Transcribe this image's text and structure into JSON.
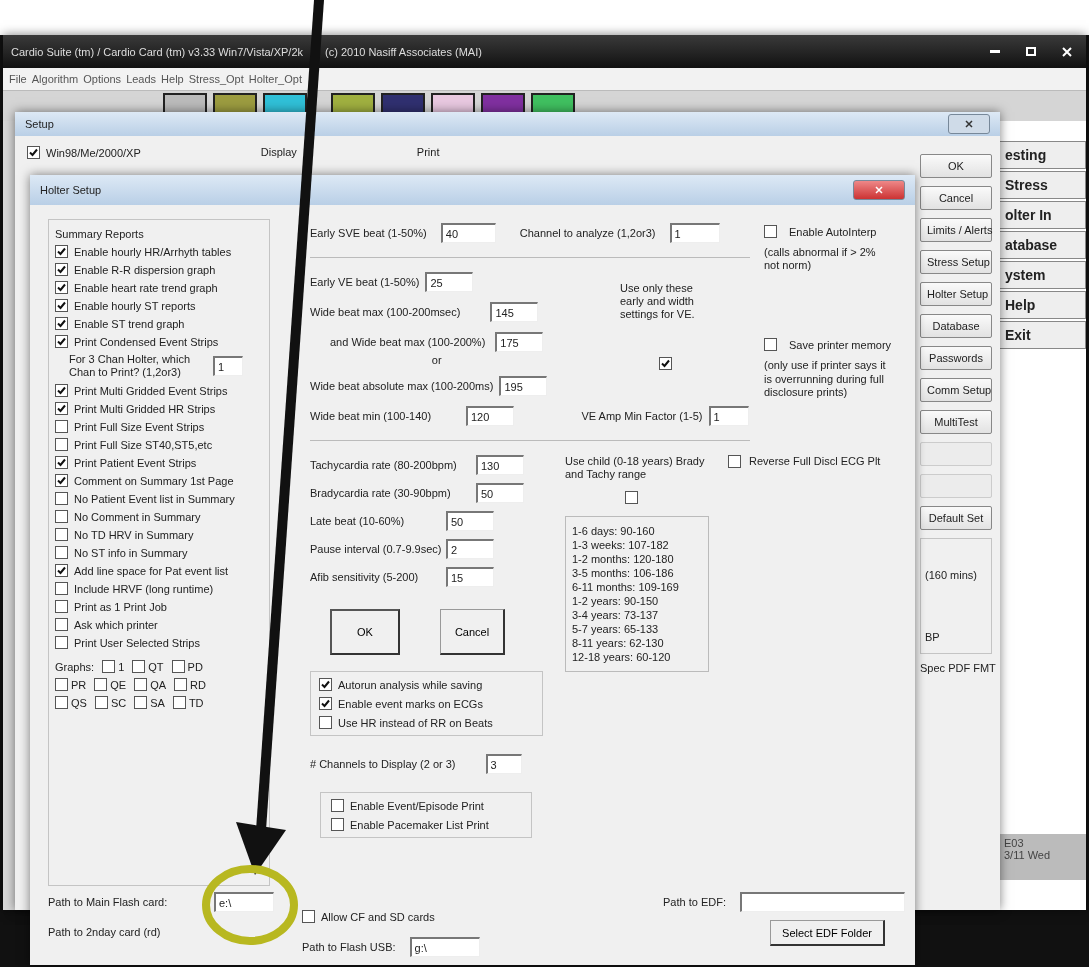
{
  "main_window": {
    "title": [
      "Cardio Suite (tm) / Cardio Card (tm) v3.33 Win7/Vista/XP/2k",
      "(c) 2010 Nasiff Associates (MAI)"
    ],
    "menu": [
      "File",
      "Algorithm",
      "Options",
      "Leads",
      "Help",
      "Stress_Opt",
      "Holter_Opt"
    ],
    "side_buttons": [
      "esting",
      "Stress",
      "olter In",
      "atabase",
      "ystem",
      "Help",
      "Exit"
    ],
    "status": [
      "E03",
      "3/11 Wed"
    ]
  },
  "setup_window": {
    "title": "Setup",
    "os_option": {
      "label": "Win98/Me/2000/XP",
      "checked": true
    },
    "headings": [
      "Display",
      "Print"
    ],
    "buttons": [
      {
        "label": "OK",
        "disabled": false
      },
      {
        "label": "Cancel",
        "disabled": false
      },
      {
        "label": "Limits / Alerts",
        "disabled": false
      },
      {
        "label": "Stress Setup",
        "disabled": false
      },
      {
        "label": "Holter Setup",
        "disabled": false
      },
      {
        "label": "Database",
        "disabled": false
      },
      {
        "label": "Passwords",
        "disabled": false
      },
      {
        "label": "Comm Setup",
        "disabled": false
      },
      {
        "label": "MultiTest",
        "disabled": false
      },
      {
        "disabled": true
      },
      {
        "disabled": true
      },
      {
        "label": "Default Set",
        "disabled": false
      }
    ],
    "group_texts": [
      "(160 mins)",
      "BP"
    ],
    "footer_text": "Spec PDF FMT"
  },
  "holter_setup": {
    "title": "Holter Setup",
    "summary_reports": {
      "title": "Summary Reports",
      "options_a": [
        {
          "label": "Enable hourly HR/Arrhyth tables",
          "checked": true
        },
        {
          "label": "Enable R-R dispersion graph",
          "checked": true
        },
        {
          "label": "Enable heart rate trend graph",
          "checked": true
        },
        {
          "label": "Enable hourly ST reports",
          "checked": true
        },
        {
          "label": "Enable ST trend graph",
          "checked": true
        },
        {
          "label": "Print Condensed Event Strips",
          "checked": true
        }
      ],
      "chan_field": {
        "label": "For 3 Chan Holter, which Chan to Print? (1,2or3)",
        "value": "1"
      },
      "options_b": [
        {
          "label": "Print Multi Gridded Event Strips",
          "checked": true
        },
        {
          "label": "Print Multi Gridded HR Strips",
          "checked": true
        },
        {
          "label": "Print Full Size Event Strips",
          "checked": false
        },
        {
          "label": "Print Full Size ST40,ST5,etc",
          "checked": false
        },
        {
          "label": "Print Patient Event Strips",
          "checked": true
        },
        {
          "label": "Comment on Summary 1st Page",
          "checked": true
        },
        {
          "label": "No Patient Event list in Summary",
          "checked": false
        },
        {
          "label": "No Comment in Summary",
          "checked": false
        },
        {
          "label": "No TD HRV in Summary",
          "checked": false
        },
        {
          "label": "No ST info in Summary",
          "checked": false
        },
        {
          "label": "Add line space for Pat event list",
          "checked": true
        },
        {
          "label": "Include HRVF (long runtime)",
          "checked": false
        },
        {
          "label": "Print as 1 Print Job",
          "checked": false
        },
        {
          "label": "Ask which printer",
          "checked": false
        },
        {
          "label": "Print User Selected Strips",
          "checked": false
        }
      ],
      "graphs_label": "Graphs:",
      "graphs": [
        [
          {
            "label": "1",
            "checked": false
          },
          {
            "label": "QT",
            "checked": false
          },
          {
            "label": "PD",
            "checked": false
          }
        ],
        [
          {
            "label": "PR",
            "checked": false
          },
          {
            "label": "QE",
            "checked": false
          },
          {
            "label": "QA",
            "checked": false
          },
          {
            "label": "RD",
            "checked": false
          }
        ],
        [
          {
            "label": "QS",
            "checked": false
          },
          {
            "label": "SC",
            "checked": false
          },
          {
            "label": "SA",
            "checked": false
          },
          {
            "label": "TD",
            "checked": false
          }
        ]
      ]
    },
    "early_sve": {
      "label": "Early SVE beat (1-50%)",
      "value": "40"
    },
    "channel": {
      "label": "Channel to analyze (1,2or3)",
      "value": "1"
    },
    "ve_fields": [
      {
        "label": "Early VE beat (1-50%)",
        "value": "25"
      },
      {
        "label": "Wide beat max (100-200msec)",
        "value": "145"
      },
      {
        "label": "and  Wide beat max (100-200%)",
        "value": "175"
      },
      {
        "label": "Wide beat absolute max (100-200ms)",
        "value": "195"
      },
      {
        "label": "Wide beat min (100-140)",
        "value": "120"
      }
    ],
    "or_text": "or",
    "ve_amp": {
      "label": "VE Amp Min Factor (1-5)",
      "value": "1"
    },
    "ve_only": {
      "label": "Use only these early and width settings for VE.",
      "checked": true
    },
    "autointerp": {
      "label": "Enable AutoInterp",
      "checked": false
    },
    "autointerp_note": "(calls abnormal if > 2% not norm)",
    "save_memory": {
      "label": "Save printer memory",
      "checked": false
    },
    "save_memory_note": "(only use if printer says it is overrunning during full disclosure prints)",
    "rate_fields": [
      {
        "label": "Tachycardia rate (80-200bpm)",
        "value": "130"
      },
      {
        "label": "Bradycardia rate (30-90bpm)",
        "value": "50"
      },
      {
        "label": "Late beat (10-60%)",
        "value": "50"
      },
      {
        "label": "Pause interval (0.7-9.9sec)",
        "value": "2"
      },
      {
        "label": "Afib sensitivity (5-200)",
        "value": "15"
      }
    ],
    "child_range": {
      "label": "Use child (0-18 years) Brady and Tachy range",
      "checked": false
    },
    "child_table": [
      "1-6 days: 90-160",
      "1-3 weeks: 107-182",
      "1-2 months: 120-180",
      "3-5 months: 106-186",
      "6-11 months: 109-169",
      "1-2 years: 90-150",
      "3-4 years: 73-137",
      "5-7 years: 65-133",
      "8-11 years: 62-130",
      "12-18 years: 60-120"
    ],
    "reverse": {
      "label": "Reverse Full Discl ECG Plt",
      "checked": false
    },
    "buttons": [
      "OK",
      "Cancel"
    ],
    "analysis_options": [
      {
        "label": "Autorun analysis while saving",
        "checked": true
      },
      {
        "label": "Enable event marks on ECGs",
        "checked": true
      },
      {
        "label": "Use HR instead of RR on Beats",
        "checked": false
      }
    ],
    "channels_display": {
      "label": "# Channels to Display (2 or 3)",
      "value": "3"
    },
    "print_options": [
      {
        "label": "Enable Event/Episode Print",
        "checked": false
      },
      {
        "label": "Enable Pacemaker List Print",
        "checked": false
      }
    ],
    "main_flash": {
      "label": "Path to Main Flash card:",
      "value": "e:\\"
    },
    "second_card": {
      "label": "Path to 2nday card (rd)"
    },
    "allow_cf": {
      "label": "Allow CF and SD cards",
      "checked": false
    },
    "flash_usb": {
      "label": "Path to Flash USB:",
      "value": "g:\\"
    },
    "edf": {
      "label": "Path to EDF:"
    },
    "edf_button": "Select EDF Folder"
  }
}
